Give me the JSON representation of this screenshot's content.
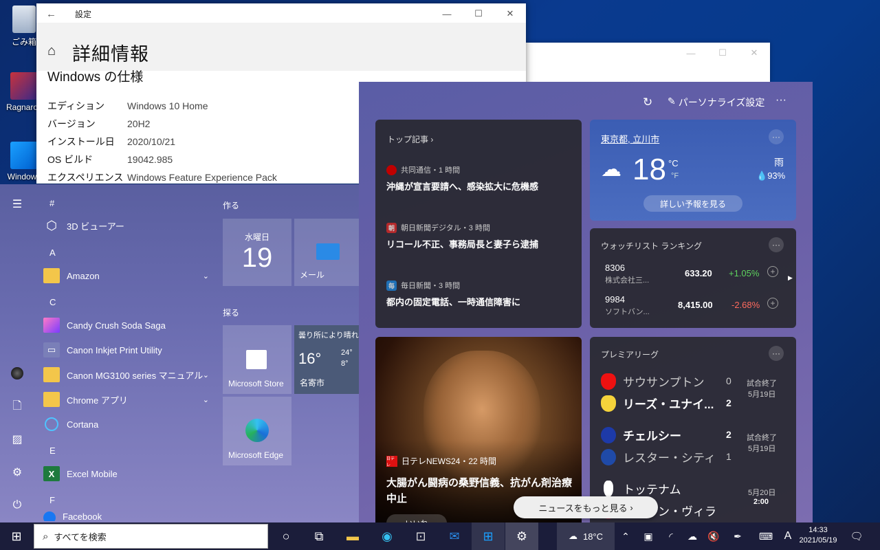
{
  "desktop": {
    "icons": [
      "ごみ箱",
      "Ragnarok",
      "Windows"
    ]
  },
  "settings": {
    "title": "設定",
    "page_title": "詳細情報",
    "section": "Windows の仕様",
    "rows": [
      {
        "k": "エディション",
        "v": "Windows 10 Home"
      },
      {
        "k": "バージョン",
        "v": "20H2"
      },
      {
        "k": "インストール日",
        "v": "2020/10/21"
      },
      {
        "k": "OS ビルド",
        "v": "19042.985"
      },
      {
        "k": "エクスペリエンス",
        "v": "Windows Feature Experience Pack"
      }
    ]
  },
  "start": {
    "letters": [
      "#",
      "A",
      "C",
      "E",
      "F"
    ],
    "apps": {
      "viewer3d": "3D ビューアー",
      "amazon": "Amazon",
      "candy": "Candy Crush Soda Saga",
      "canon_print": "Canon Inkjet Print Utility",
      "canon_manual": "Canon MG3100 series マニュアル",
      "chrome": "Chrome アプリ",
      "cortana": "Cortana",
      "excel": "Excel Mobile",
      "f_partial": "Facebook"
    },
    "groups": {
      "make": "作る",
      "explore": "探る"
    },
    "tiles": {
      "cal_day": "水曜日",
      "cal_date": "19",
      "mail": "メール",
      "store": "Microsoft Store",
      "edge": "Microsoft Edge",
      "weather_desc": "曇り所により晴れ",
      "weather_temp": "16°",
      "weather_hi": "24°",
      "weather_lo": "8°",
      "weather_city": "名寄市"
    }
  },
  "widgets": {
    "personalize": "パーソナライズ設定",
    "top_stories": {
      "header": "トップ記事",
      "items": [
        {
          "src": "共同通信・1 時間",
          "title": "沖縄が宣言要請へ、感染拡大に危機感",
          "color": "#c00000",
          "icon": ""
        },
        {
          "src": "朝日新聞デジタル・3 時間",
          "title": "リコール不正、事務局長と妻子ら逮捕",
          "color": "#b5292b",
          "icon": "朝"
        },
        {
          "src": "毎日新聞・3 時間",
          "title": "都内の固定電話、一時通信障害に",
          "color": "#1f6fb5",
          "icon": "毎"
        }
      ]
    },
    "weather": {
      "location": "東京都, 立川市",
      "temp": "18",
      "unit_c": "°C",
      "unit_f": "°F",
      "cond": "雨",
      "precip": "93%",
      "button": "詳しい予報を見る"
    },
    "watchlist": {
      "header": "ウォッチリスト ランキング",
      "rows": [
        {
          "code": "8306",
          "name": "株式会社三...",
          "price": "633.20",
          "change": "+1.05%",
          "color": "#5ed35e"
        },
        {
          "code": "9984",
          "name": "ソフトバン...",
          "price": "8,415.00",
          "change": "-2.68%",
          "color": "#ff6b5e"
        }
      ]
    },
    "photo_news": {
      "src": "日テレNEWS24・22 時間",
      "src_icon": "日テレ",
      "title": "大腸がん闘病の桑野信義、抗がん剤治療中止"
    },
    "premier": {
      "header": "プレミアリーグ",
      "matches": [
        {
          "t1": "サウサンプトン",
          "s1": "0",
          "t2": "リーズ・ユナイ...",
          "s2": "2",
          "status": "試合終了",
          "date": "5月19日"
        },
        {
          "t1": "チェルシー",
          "s1": "2",
          "t2": "レスター・シティ",
          "s2": "1",
          "status": "試合終了",
          "date": "5月19日"
        },
        {
          "t1": "トッテナム",
          "t2": "アストン・ヴィラ",
          "date": "5月20日",
          "time": "2:00"
        }
      ]
    },
    "more_news": "ニュースをもっと見る",
    "like": "いいね"
  },
  "taskbar": {
    "search_placeholder": "すべてを検索",
    "weather_temp": "18°C",
    "ime": "A",
    "time": "14:33",
    "date": "2021/05/19"
  }
}
